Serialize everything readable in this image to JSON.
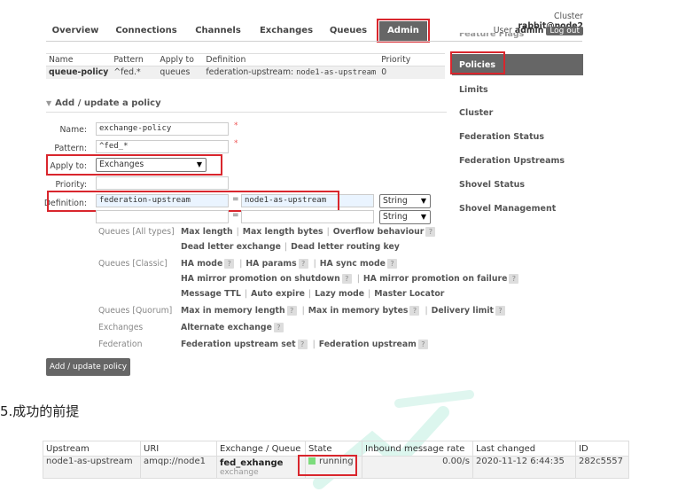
{
  "nav": {
    "tabs": [
      "Overview",
      "Connections",
      "Channels",
      "Exchanges",
      "Queues",
      "Admin"
    ],
    "cluster_label": "Cluster",
    "cluster_name": "rabbit@node2",
    "user_label": "User",
    "user_name": "admin",
    "logout_label": "Log out"
  },
  "policies_table": {
    "headers": [
      "Name",
      "Pattern",
      "Apply to",
      "Definition",
      "Priority"
    ],
    "row": {
      "name": "queue-policy",
      "pattern": "^fed.*",
      "apply_to": "queues",
      "definition_key": "federation-upstream:",
      "definition_value": "node1-as-upstream",
      "priority": "0"
    }
  },
  "sidebar": {
    "items": [
      "Feature Flags",
      "Policies",
      "Limits",
      "Cluster",
      "Federation Status",
      "Federation Upstreams",
      "Shovel Status",
      "Shovel Management"
    ]
  },
  "form": {
    "section_title": "Add / update a policy",
    "name_label": "Name:",
    "name_value": "exchange-policy",
    "pattern_label": "Pattern:",
    "pattern_value": "^fed_*",
    "apply_label": "Apply to:",
    "apply_value": "Exchanges",
    "priority_label": "Priority:",
    "priority_value": "",
    "definition_label": "Definition:",
    "def_key": "federation-upstream",
    "def_value": "node1-as-upstream",
    "def_type": "String",
    "def_key2": "",
    "def_value2": "",
    "def_type2": "String",
    "equals": "=",
    "required_mark": "*",
    "submit_label": "Add / update policy"
  },
  "hints": {
    "categories": [
      "Queues [All types]",
      "Queues [Classic]",
      "Queues [Quorum]",
      "Exchanges",
      "Federation"
    ],
    "all_line1": [
      "Max length",
      "Max length bytes",
      "Overflow behaviour"
    ],
    "all_line2": [
      "Dead letter exchange",
      "Dead letter routing key"
    ],
    "classic_line1": [
      "HA mode",
      "HA params",
      "HA sync mode"
    ],
    "classic_line2": [
      "HA mirror promotion on shutdown",
      "HA mirror promotion on failure"
    ],
    "classic_line3": [
      "Message TTL",
      "Auto expire",
      "Lazy mode",
      "Master Locator"
    ],
    "quorum_line": [
      "Max in memory length",
      "Max in memory bytes",
      "Delivery limit"
    ],
    "exchanges_line": [
      "Alternate exchange"
    ],
    "federation_line": [
      "Federation upstream set",
      "Federation upstream"
    ],
    "help_mark": "?",
    "sep": "|"
  },
  "note": {
    "heading": "5.成功的前提"
  },
  "upstream_table": {
    "headers": [
      "Upstream",
      "URI",
      "Exchange / Queue",
      "State",
      "Inbound message rate",
      "Last changed",
      "ID"
    ],
    "row": {
      "upstream": "node1-as-upstream",
      "uri": "amqp://node1",
      "exchange": "fed_exhange",
      "exchange_type": "exchange",
      "state": "running",
      "rate": "0.00/s",
      "last_changed": "2020-11-12 6:44:35",
      "id": "282c5557"
    }
  },
  "colors": {
    "accent_red": "#d9262d",
    "nav_dark": "#666666",
    "running_green": "#7ddc7d"
  }
}
